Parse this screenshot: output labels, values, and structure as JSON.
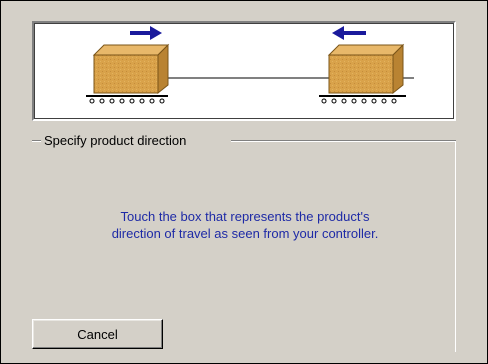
{
  "group": {
    "label": "Specify product direction"
  },
  "instructions": {
    "line1": "Touch the box that represents the product's",
    "line2": "direction of travel as seen from your controller."
  },
  "buttons": {
    "cancel_label": "Cancel"
  },
  "illustration": {
    "left_box": {
      "direction": "right",
      "icon": "arrow-right-icon"
    },
    "right_box": {
      "direction": "left",
      "icon": "arrow-left-icon"
    }
  },
  "colors": {
    "dialog_bg": "#d4d0c8",
    "instruction_text": "#1e2aa6",
    "arrow": "#1a1a9c",
    "box_fill": "#d9a24a",
    "box_side": "#b98332"
  }
}
